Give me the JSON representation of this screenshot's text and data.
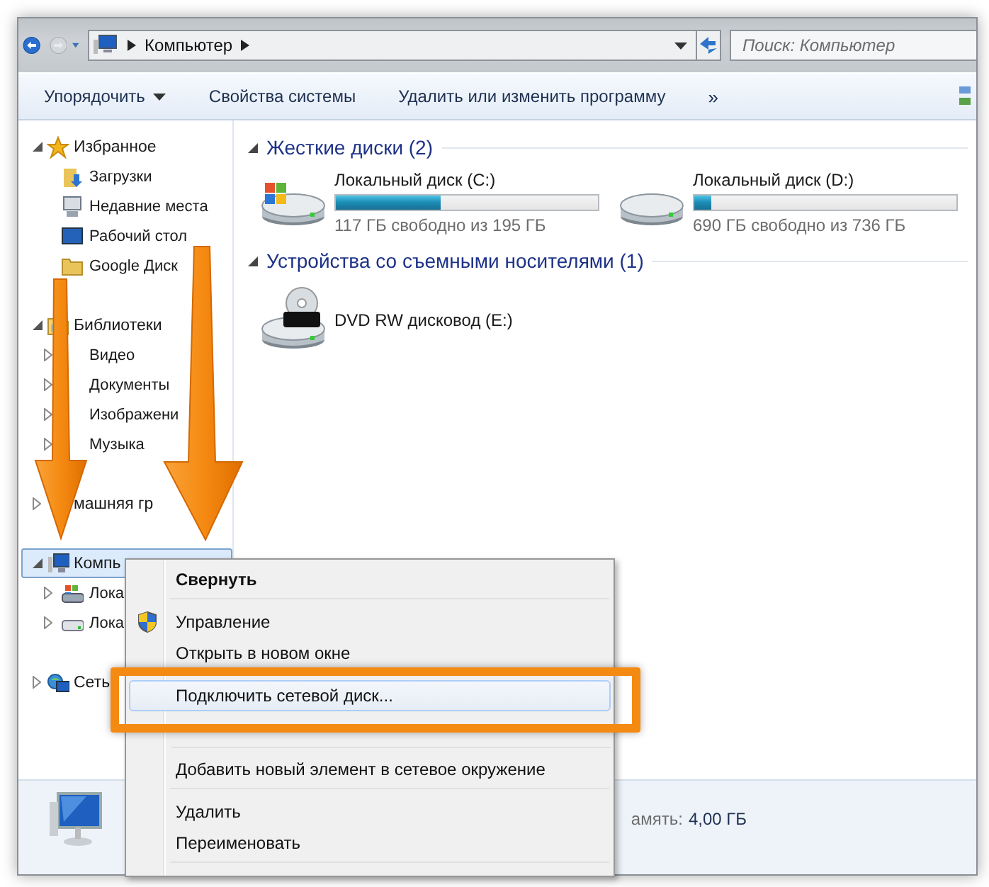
{
  "navigation": {
    "back": {
      "disabled": false
    },
    "forward": {
      "disabled": true
    },
    "address": [
      "Компьютер"
    ],
    "search": {
      "placeholder": "Поиск: Компьютер"
    }
  },
  "command_bar": {
    "items": [
      {
        "label": "Упорядочить",
        "dropdown": true
      },
      {
        "label": "Свойства системы",
        "dropdown": false
      },
      {
        "label": "Удалить или изменить программу",
        "dropdown": false
      }
    ],
    "overflow": "»"
  },
  "sidebar": {
    "items": [
      {
        "label": "Избранное",
        "expanded": true,
        "selected": false,
        "children": [
          {
            "label": "Загрузки",
            "selected": false
          },
          {
            "label": "Недавние места",
            "selected": false
          },
          {
            "label": "Рабочий стол",
            "selected": false
          },
          {
            "label": "Google Диск",
            "selected": false
          }
        ]
      },
      {
        "label": "Библиотеки",
        "expanded": true,
        "selected": false,
        "children": [
          {
            "label": "Видео",
            "expanded": false,
            "selected": false
          },
          {
            "label": "Документы",
            "expanded": false,
            "selected": false
          },
          {
            "label": "Изображени",
            "expanded": false,
            "selected": false
          },
          {
            "label": "Музыка",
            "expanded": false,
            "selected": false
          }
        ]
      },
      {
        "label": "машняя гр",
        "expanded": false,
        "selected": false
      },
      {
        "label": "Компь",
        "expanded": true,
        "selected": true,
        "children": [
          {
            "label": "Лока",
            "expanded": false,
            "selected": false
          },
          {
            "label": "Лока",
            "expanded": false,
            "selected": false
          }
        ]
      },
      {
        "label": "Сеть",
        "expanded": false,
        "selected": false
      }
    ]
  },
  "sections": [
    {
      "title": "Жесткие диски (2)",
      "expanded": true,
      "items": [
        {
          "kind": "system",
          "name": "Локальный диск (C:)",
          "level": 0.4,
          "info": "117 ГБ свободно из 195 ГБ"
        },
        {
          "kind": "disk",
          "name": "Локальный диск (D:)",
          "level": 0.0625,
          "info": "690 ГБ свободно из 736 ГБ"
        }
      ]
    },
    {
      "title": "Устройства со съемными носителями (1)",
      "expanded": true,
      "items": [
        {
          "kind": "optical",
          "name": "DVD RW дисковод (E:)"
        }
      ]
    }
  ],
  "details": {
    "label": "амять:",
    "value": "4,00 ГБ"
  },
  "context_menu": {
    "items": [
      {
        "label": "Свернуть",
        "default": true,
        "highlighted": false,
        "icon": false,
        "separator_after": true
      },
      {
        "label": "Управление",
        "default": false,
        "highlighted": false,
        "icon": true,
        "separator_after": false
      },
      {
        "label": "Открыть в новом окне",
        "default": false,
        "highlighted": false,
        "icon": false,
        "separator_after": false
      },
      {
        "label": "Подключить сетевой диск...",
        "default": false,
        "highlighted": true,
        "icon": false,
        "separator_after": false
      },
      {
        "label": "Добавить новый элемент в сетевое окружение",
        "default": false,
        "highlighted": false,
        "icon": false,
        "separator_after": true
      },
      {
        "label": "Удалить",
        "default": false,
        "highlighted": false,
        "icon": false,
        "separator_after": false
      },
      {
        "label": "Переименовать",
        "default": false,
        "highlighted": false,
        "icon": false,
        "separator_after": true
      }
    ]
  }
}
